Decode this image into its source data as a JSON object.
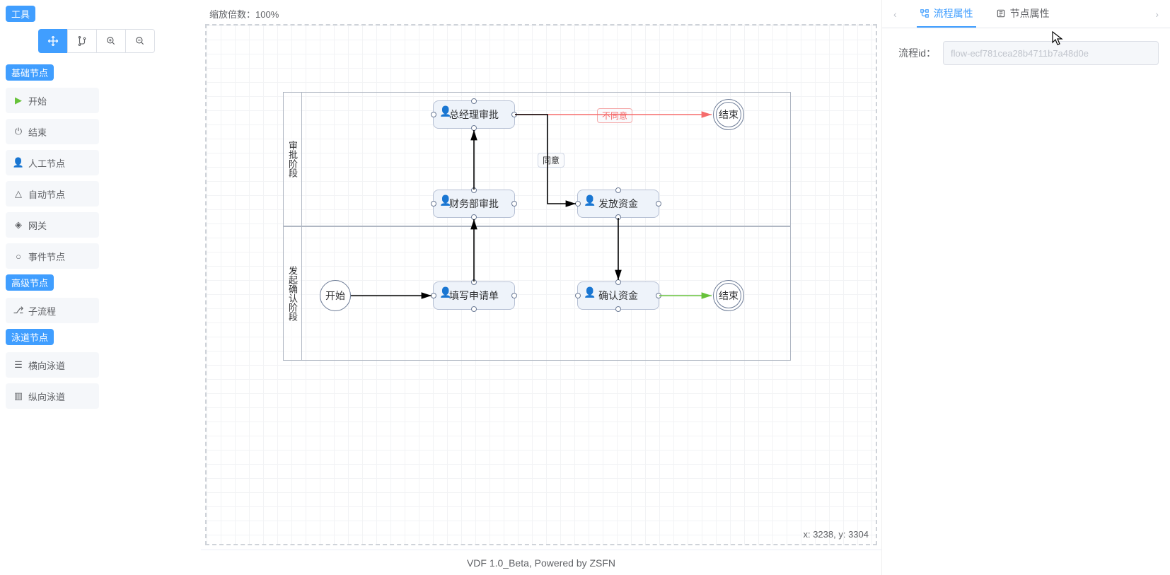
{
  "sidebar": {
    "tools_label": "工具",
    "tool_buttons": [
      "move",
      "branch",
      "zoom-in",
      "zoom-out"
    ],
    "sections": {
      "basic": {
        "title": "基础节点",
        "items": [
          {
            "icon": "play-icon",
            "label": "开始"
          },
          {
            "icon": "power-icon",
            "label": "结束"
          },
          {
            "icon": "person-icon",
            "label": "人工节点"
          },
          {
            "icon": "auto-icon",
            "label": "自动节点"
          },
          {
            "icon": "diamond-icon",
            "label": "网关"
          },
          {
            "icon": "circle-icon",
            "label": "事件节点"
          }
        ]
      },
      "advanced": {
        "title": "高级节点",
        "items": [
          {
            "icon": "sub-icon",
            "label": "子流程"
          }
        ]
      },
      "lane": {
        "title": "泳道节点",
        "items": [
          {
            "icon": "hlane-icon",
            "label": "横向泳道"
          },
          {
            "icon": "vlane-icon",
            "label": "纵向泳道"
          }
        ]
      }
    }
  },
  "toolbar": {
    "icons": [
      "save-icon",
      "image-icon",
      "delete-icon",
      "eye-icon",
      "gear-icon",
      "screen-icon",
      "refresh-icon"
    ]
  },
  "canvas": {
    "zoom_label_prefix": "缩放倍数：",
    "zoom_value": "100%",
    "coords_prefix_x": "x: ",
    "coords_x": "3238",
    "coords_mid": ", y: ",
    "coords_y": "3304",
    "lanes": [
      {
        "title": "审批阶段"
      },
      {
        "title": "发起确认阶段"
      }
    ],
    "nodes": {
      "start": "开始",
      "fill_form": "填写申请单",
      "finance_approve": "财务部审批",
      "gm_approve": "总经理审批",
      "release_fund": "发放资金",
      "confirm_fund": "确认资金",
      "end1": "结束",
      "end2": "结束"
    },
    "edges": {
      "agree": "同意",
      "disagree": "不同意"
    }
  },
  "right_panel": {
    "tab_flow": "流程属性",
    "tab_node": "节点属性",
    "flow_id_label": "流程id：",
    "flow_id_value": "flow-ecf781cea28b4711b7a48d0e"
  },
  "footer": {
    "text": "VDF 1.0_Beta, Powered by ZSFN"
  },
  "colors": {
    "primary": "#409eff",
    "danger": "#f56c6c",
    "success": "#67c23a",
    "border": "#b6c0d4"
  },
  "chart_data": {
    "type": "flowchart-swimlane",
    "orientation": "horizontal",
    "lanes": [
      {
        "id": "lane-approve",
        "title": "审批阶段"
      },
      {
        "id": "lane-initiate",
        "title": "发起确认阶段"
      }
    ],
    "nodes": [
      {
        "id": "start",
        "type": "start",
        "label": "开始",
        "lane": "lane-initiate"
      },
      {
        "id": "fill_form",
        "type": "user-task",
        "label": "填写申请单",
        "lane": "lane-initiate"
      },
      {
        "id": "finance_approve",
        "type": "user-task",
        "label": "财务部审批",
        "lane": "lane-approve"
      },
      {
        "id": "gm_approve",
        "type": "user-task",
        "label": "总经理审批",
        "lane": "lane-approve"
      },
      {
        "id": "release_fund",
        "type": "user-task",
        "label": "发放资金",
        "lane": "lane-approve"
      },
      {
        "id": "confirm_fund",
        "type": "user-task",
        "label": "确认资金",
        "lane": "lane-initiate"
      },
      {
        "id": "end1",
        "type": "end",
        "label": "结束",
        "lane": "lane-approve"
      },
      {
        "id": "end2",
        "type": "end",
        "label": "结束",
        "lane": "lane-initiate"
      }
    ],
    "edges": [
      {
        "from": "start",
        "to": "fill_form",
        "label": ""
      },
      {
        "from": "fill_form",
        "to": "finance_approve",
        "label": ""
      },
      {
        "from": "finance_approve",
        "to": "gm_approve",
        "label": ""
      },
      {
        "from": "gm_approve",
        "to": "end1",
        "label": "不同意",
        "color": "red"
      },
      {
        "from": "gm_approve",
        "to": "release_fund",
        "label": "同意"
      },
      {
        "from": "release_fund",
        "to": "confirm_fund",
        "label": ""
      },
      {
        "from": "confirm_fund",
        "to": "end2",
        "label": "",
        "color": "green"
      }
    ]
  }
}
